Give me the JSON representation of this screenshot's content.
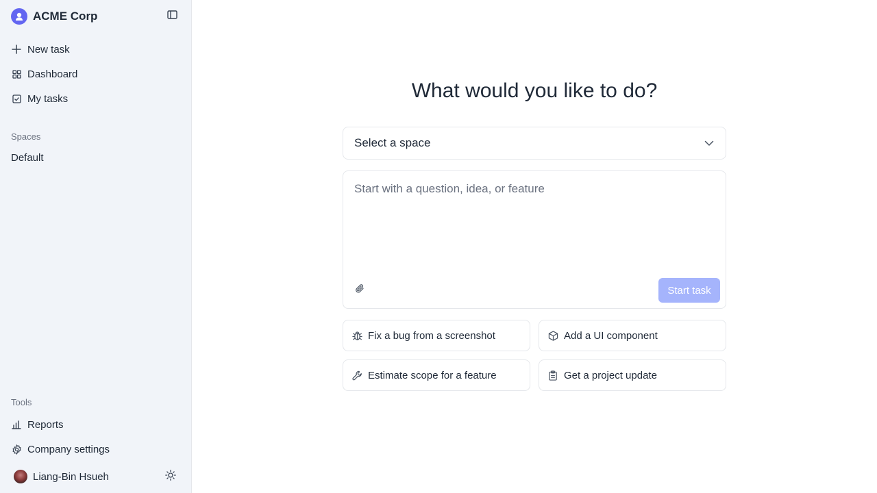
{
  "sidebar": {
    "brand": {
      "name": "ACME Corp",
      "logo_icon": "company-logo-icon"
    },
    "nav": [
      {
        "label": "New task",
        "icon": "plus-icon"
      },
      {
        "label": "Dashboard",
        "icon": "grid-icon"
      },
      {
        "label": "My tasks",
        "icon": "check-square-icon"
      }
    ],
    "spaces_heading": "Spaces",
    "spaces": [
      {
        "label": "Default"
      }
    ],
    "tools_heading": "Tools",
    "tools": [
      {
        "label": "Reports",
        "icon": "bar-chart-icon"
      },
      {
        "label": "Company settings",
        "icon": "gear-icon"
      }
    ],
    "user": {
      "name": "Liang-Bin Hsueh"
    }
  },
  "main": {
    "headline": "What would you like to do?",
    "space_select": {
      "value": "Select a space"
    },
    "composer": {
      "placeholder": "Start with a question, idea, or feature",
      "submit_label": "Start task"
    },
    "suggestions": [
      {
        "label": "Fix a bug from a screenshot",
        "icon": "bug-icon"
      },
      {
        "label": "Add a UI component",
        "icon": "box-icon"
      },
      {
        "label": "Estimate scope for a feature",
        "icon": "wrench-icon"
      },
      {
        "label": "Get a project update",
        "icon": "clipboard-icon"
      }
    ]
  },
  "colors": {
    "accent": "#6366f1",
    "accent_disabled": "#a5b4fc",
    "sidebar_bg": "#f1f4f9",
    "border": "#e5e7eb",
    "text": "#1f2937",
    "muted": "#6b7280"
  }
}
